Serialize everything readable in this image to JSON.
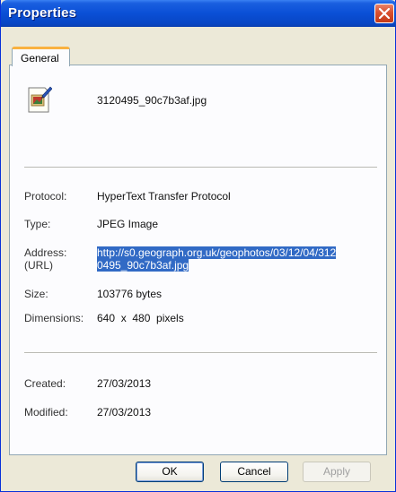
{
  "window": {
    "title": "Properties"
  },
  "tabs": [
    {
      "label": "General"
    }
  ],
  "file": {
    "name": "3120495_90c7b3af.jpg",
    "icon": "jpeg-image-file-icon"
  },
  "details": {
    "protocol_label": "Protocol:",
    "protocol_value": "HyperText Transfer Protocol",
    "type_label": "Type:",
    "type_value": "JPEG Image",
    "address_label_1": "Address:",
    "address_label_2": "(URL)",
    "address_value_line1": "http://s0.geograph.org.uk/geophotos/03/12/04/312",
    "address_value_line2": "0495_90c7b3af.jpg",
    "size_label": "Size:",
    "size_value": "103776 bytes",
    "dimensions_label": "Dimensions:",
    "dimensions_value": "640  x  480  pixels",
    "created_label": "Created:",
    "created_value": "27/03/2013",
    "modified_label": "Modified:",
    "modified_value": "27/03/2013"
  },
  "buttons": {
    "ok": "OK",
    "cancel": "Cancel",
    "apply": "Apply"
  },
  "colors": {
    "titlebar": "#0a4fd6",
    "selection": "#316ac5",
    "tab_accent": "#f9b140",
    "close": "#d8502f"
  }
}
